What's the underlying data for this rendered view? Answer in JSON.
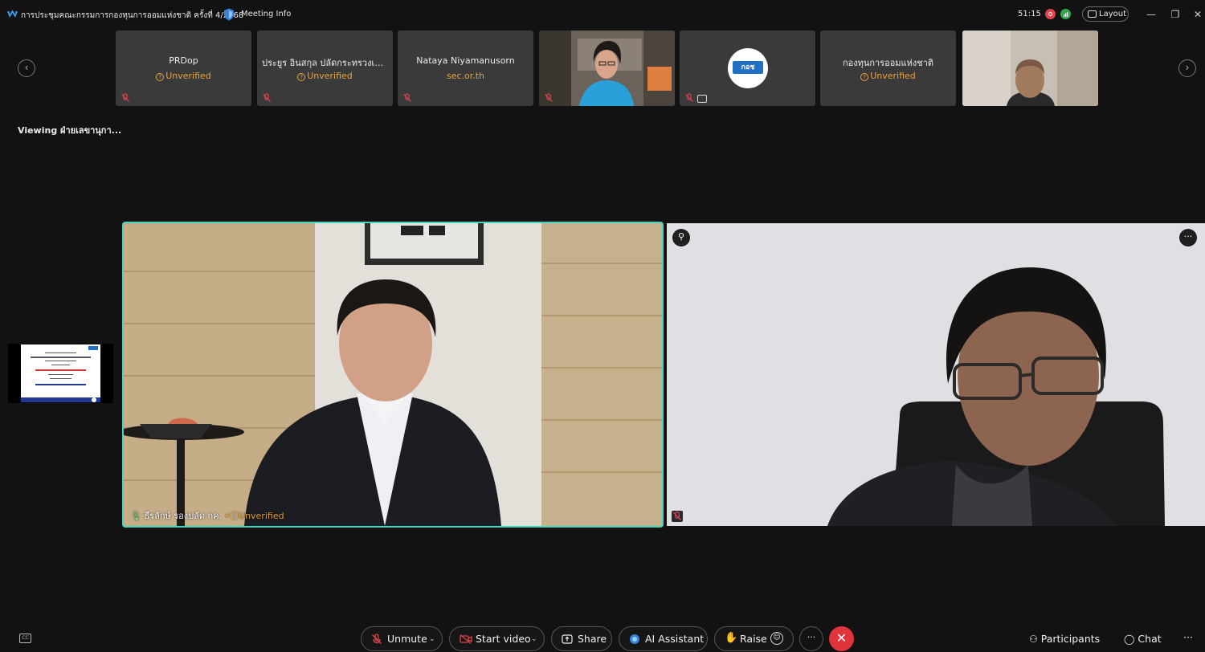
{
  "titlebar": {
    "meeting_title": "การประชุมคณะกรรมการกองทุนการออมแห่งชาติ ครั้งที่ 4/2568",
    "meeting_info": "Meeting Info",
    "timer": "51:15",
    "layout_label": "Layout"
  },
  "filmstrip": {
    "tiles": [
      {
        "name": "PRDop",
        "sub": "Unverified",
        "sub_type": "unverified"
      },
      {
        "name": "ประยูร อินสกุล ปลัดกระทรวงเก...",
        "sub": "Unverified",
        "sub_type": "unverified"
      },
      {
        "name": "Nataya Niyamanusorn",
        "sub": "sec.or.th",
        "sub_type": "domain"
      },
      {
        "name": "",
        "sub": "",
        "sub_type": "video"
      },
      {
        "name": "",
        "sub": "",
        "sub_type": "logo",
        "logo_text": "กอช"
      },
      {
        "name": "กองทุนการออมแห่งชาติ",
        "sub": "Unverified",
        "sub_type": "unverified"
      },
      {
        "name": "",
        "sub": "",
        "sub_type": "video"
      }
    ]
  },
  "viewing_label": "Viewing ฝ่ายเลขานุกา...",
  "main_videos": [
    {
      "name": "ธีรลักษ์ รองปลัด กค.",
      "status": "Unverified"
    }
  ],
  "controls": {
    "unmute": "Unmute",
    "start_video": "Start video",
    "share": "Share",
    "ai_assistant": "AI Assistant",
    "raise": "Raise",
    "more": "···",
    "participants": "Participants",
    "chat": "Chat",
    "overflow": "···",
    "cc": "CC"
  },
  "colors": {
    "active_speaker_border": "#43d7c3",
    "unverified": "#e8a33b",
    "end_call": "#e0343c",
    "muted_icon": "#e0434b"
  }
}
